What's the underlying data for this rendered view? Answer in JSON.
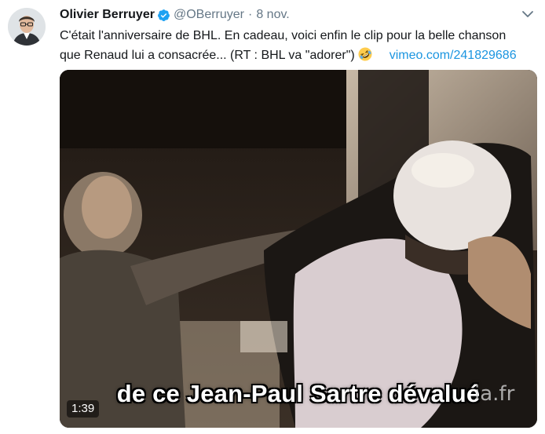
{
  "tweet": {
    "author": {
      "display_name": "Olivier Berruyer",
      "handle": "@OBerruyer",
      "verified": true,
      "avatar_icon": "avatar-photo"
    },
    "separator": "·",
    "timestamp": "8 nov.",
    "text_line_1": "C'était l'anniversaire de BHL.  En cadeau, voici enfin le clip pour la belle chanson",
    "text_line_2": "que Renaud lui a consacrée...  (RT : BHL va \"adorer\")",
    "emoji": "rolling-on-floor-laughing",
    "link_text": "vimeo.com/241829686"
  },
  "video": {
    "subtitle": "de ce Jean-Paul Sartre dévalué",
    "watermark": "ia.fr",
    "duration": "1:39"
  },
  "colors": {
    "text": "#14171a",
    "secondary": "#657786",
    "link": "#1b95e0",
    "verified": "#1da1f2"
  }
}
